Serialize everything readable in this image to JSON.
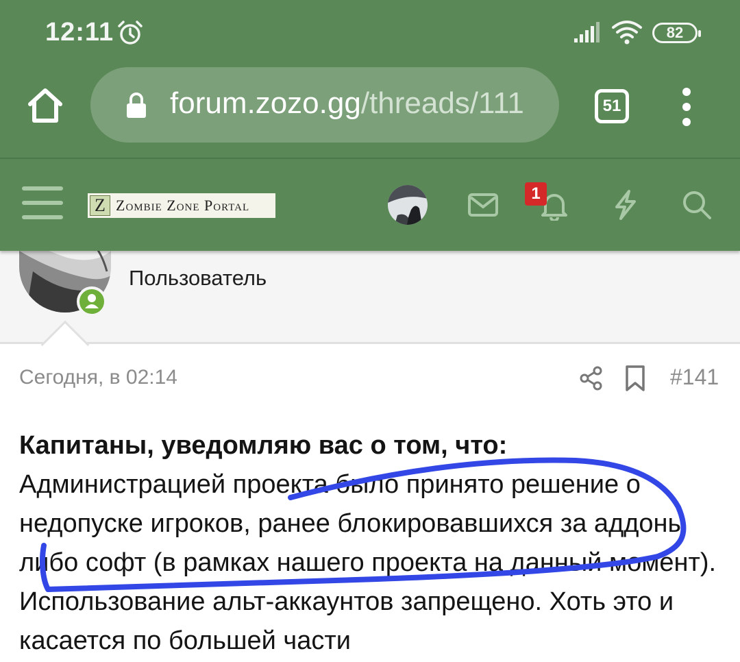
{
  "status_bar": {
    "time": "12:11",
    "battery": "82",
    "icons": [
      "alarm-icon",
      "signal-icon",
      "wifi-icon",
      "battery-icon"
    ]
  },
  "browser": {
    "url_host": "forum.zozo.gg",
    "url_path": "/threads/111",
    "tab_count": "51",
    "icons": [
      "home-icon",
      "lock-icon",
      "tabs-icon",
      "more-vert-icon"
    ]
  },
  "forum_header": {
    "logo_letter": "Z",
    "logo_text": "Zombie Zone Portal",
    "notification_count": "1",
    "icons": [
      "menu-icon",
      "avatar",
      "mail-icon",
      "bell-icon",
      "lightning-icon",
      "search-icon"
    ]
  },
  "user": {
    "role": "Пользователь",
    "status_color": "#6fb03a"
  },
  "post": {
    "date": "Сегодня, в 02:14",
    "number": "#141",
    "lead": "Капитаны, уведомляю вас о том, что:",
    "text": "Администрацией проекта было принято решение о недопуске игроков, ранее блокировавшихся за аддоны либо софт (в рамках нашего проекта на данный момент). Использование альт-аккаунтов запрещено. Хоть это и касается по большей части"
  },
  "colors": {
    "header_green": "#5a8857",
    "urlbar_green": "#7ca079",
    "annotation_blue": "#3347e6",
    "badge_red": "#d52929"
  }
}
